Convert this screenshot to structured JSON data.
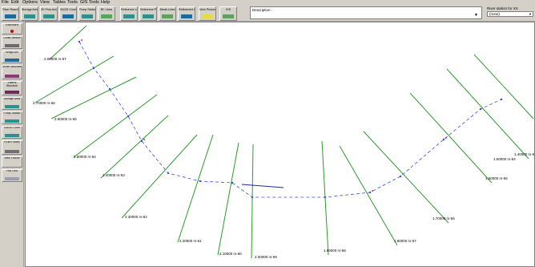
{
  "menu": [
    "File",
    "Edit",
    "Options",
    "View",
    "Tables",
    "Tools",
    "GIS Tools",
    "Help"
  ],
  "toolbar": [
    {
      "label": "River Reach",
      "icon": "river-reach-icon"
    },
    {
      "label": "Storage Area",
      "icon": "storage-area-icon"
    },
    {
      "label": "2D Flow Area",
      "icon": "flow-area-2d-icon"
    },
    {
      "label": "SA/2D Conn",
      "icon": "sa-connection-icon"
    },
    {
      "label": "Pump Station",
      "icon": "pump-station-icon"
    },
    {
      "label": "BC Lines",
      "icon": "bc-lines-icon"
    },
    {
      "label": "Reference Lines",
      "icon": "reference-lines-icon"
    },
    {
      "label": "Reference Points",
      "icon": "reference-points-icon"
    },
    {
      "label": "Break Lines",
      "icon": "break-lines-icon"
    },
    {
      "label": "Refinement Region",
      "icon": "refinement-region-icon"
    },
    {
      "label": "View Picture",
      "icon": "view-picture-icon"
    },
    {
      "label": "GIS",
      "icon": "gis-icon"
    }
  ],
  "description": {
    "label": "Description :",
    "value": ""
  },
  "river_selector": {
    "label": "River station for XS",
    "value": "(none)"
  },
  "left_toolbar": [
    "Edit/Insert",
    "Cross Section",
    "Brdg/Culv",
    "Inline Structure",
    "Lateral Structure",
    "Storage Area",
    "Pump Station",
    "SA/2D Conn",
    "HTab Param",
    "View Picture",
    "Plot Grid"
  ],
  "cross_sections": [
    {
      "label": "2.00000",
      "suffix": "rs-67"
    },
    {
      "label": "2.70000",
      "suffix": "rs-66"
    },
    {
      "label": "2.60000",
      "suffix": "rs-65"
    },
    {
      "label": "2.50000",
      "suffix": "rs-64"
    },
    {
      "label": "2.40000",
      "suffix": "rs-63"
    },
    {
      "label": "2.30000",
      "suffix": "rs-62"
    },
    {
      "label": "2.20000",
      "suffix": "rs-61"
    },
    {
      "label": "2.10000",
      "suffix": "rs-60"
    },
    {
      "label": "2.00000",
      "suffix": "rs-59"
    },
    {
      "label": "1.90000",
      "suffix": "rs-58"
    },
    {
      "label": "1.80000",
      "suffix": "rs-57"
    },
    {
      "label": "1.70000",
      "suffix": "rs-56"
    },
    {
      "label": "1.60000",
      "suffix": "rs-55"
    },
    {
      "label": "1.50000",
      "suffix": "rs-54"
    },
    {
      "label": "1.40000",
      "suffix": "rs-53"
    }
  ],
  "colors": {
    "xs_line": "#2e9a2e",
    "river_line": "#3b4fe0",
    "bank": "#d00000",
    "canvas_bg": "#ffffff"
  }
}
